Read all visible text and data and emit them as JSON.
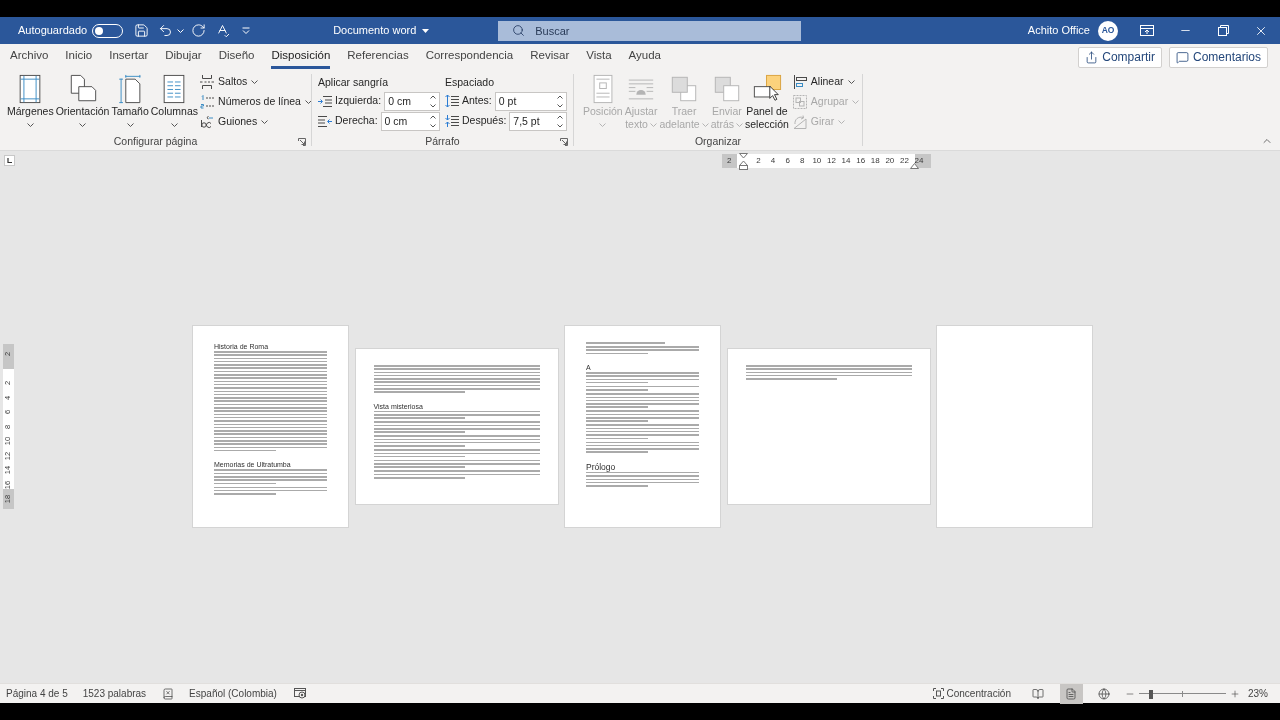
{
  "title_bar": {
    "autosave": {
      "label": "Autoguardado",
      "on": false
    },
    "document_title": "Documento word",
    "search": {
      "placeholder": "Buscar"
    },
    "user": {
      "name": "Achito Office",
      "initials": "AO"
    }
  },
  "tabs": [
    {
      "label": "Archivo",
      "selected": false
    },
    {
      "label": "Inicio",
      "selected": false
    },
    {
      "label": "Insertar",
      "selected": false
    },
    {
      "label": "Dibujar",
      "selected": false
    },
    {
      "label": "Diseño",
      "selected": false
    },
    {
      "label": "Disposición",
      "selected": true
    },
    {
      "label": "Referencias",
      "selected": false
    },
    {
      "label": "Correspondencia",
      "selected": false
    },
    {
      "label": "Revisar",
      "selected": false
    },
    {
      "label": "Vista",
      "selected": false
    },
    {
      "label": "Ayuda",
      "selected": false
    }
  ],
  "header_buttons": [
    {
      "kind": "share",
      "label": "Compartir"
    },
    {
      "kind": "comments",
      "label": "Comentarios"
    }
  ],
  "ribbon": {
    "page_setup": {
      "label": "Configurar página",
      "large_buttons": [
        {
          "kind": "margins",
          "lines": [
            "Márgenes"
          ],
          "menu": true
        },
        {
          "kind": "orientation",
          "lines": [
            "Orientación"
          ],
          "menu": true
        },
        {
          "kind": "size",
          "lines": [
            "Tamaño"
          ],
          "menu": true
        },
        {
          "kind": "columns",
          "lines": [
            "Columnas"
          ],
          "menu": true
        }
      ],
      "small_buttons": [
        {
          "kind": "breaks",
          "label": "Saltos",
          "menu": true
        },
        {
          "kind": "line_numbers",
          "label": "Números de línea",
          "menu": true
        },
        {
          "kind": "hyphenation",
          "label": "Guiones",
          "menu": true
        }
      ]
    },
    "paragraph": {
      "label": "Párrafo",
      "sections": [
        {
          "label": "Aplicar sangría",
          "fields": [
            {
              "kind": "indent_left",
              "label": "Izquierda:",
              "value": "0 cm"
            },
            {
              "kind": "indent_right",
              "label": "Derecha:",
              "value": "0 cm"
            }
          ]
        },
        {
          "label": "Espaciado",
          "fields": [
            {
              "kind": "spacing_before",
              "label": "Antes:",
              "value": "0 pt"
            },
            {
              "kind": "spacing_after",
              "label": "Después:",
              "value": "7,5 pt"
            }
          ]
        }
      ]
    },
    "arrange": {
      "label": "Organizar",
      "large_buttons": [
        {
          "kind": "position",
          "lines": [
            "Posición"
          ],
          "menu": true,
          "disabled": true
        },
        {
          "kind": "wrap_text",
          "lines": [
            "Ajustar",
            "texto"
          ],
          "menu": true,
          "disabled": true
        },
        {
          "kind": "bring_forward",
          "lines": [
            "Traer",
            "adelante"
          ],
          "menu": true,
          "disabled": true
        },
        {
          "kind": "send_backward",
          "lines": [
            "Enviar",
            "atrás"
          ],
          "menu": true,
          "disabled": true
        },
        {
          "kind": "selection_pane",
          "lines": [
            "Panel de",
            "selección"
          ],
          "menu": false,
          "disabled": false
        }
      ],
      "small_buttons": [
        {
          "kind": "align",
          "label": "Alinear",
          "menu": true,
          "disabled": false
        },
        {
          "kind": "group",
          "label": "Agrupar",
          "menu": true,
          "disabled": true
        },
        {
          "kind": "rotate",
          "label": "Girar",
          "menu": true,
          "disabled": true
        }
      ]
    }
  },
  "horizontal_ruler": {
    "ticks": [
      "2",
      "2",
      "4",
      "6",
      "8",
      "10",
      "12",
      "14",
      "16",
      "18",
      "20",
      "22",
      "24"
    ]
  },
  "vertical_ruler": {
    "ticks": [
      "2",
      "2",
      "4",
      "6",
      "8",
      "10",
      "12",
      "14",
      "16",
      "18"
    ]
  },
  "pages": [
    {
      "kind": "portrait",
      "blocks": [
        {
          "kind": "heading",
          "text": "Historia de Roma"
        },
        {
          "kind": "text_block"
        },
        {
          "kind": "heading",
          "text": "Memorias de Ultratumba"
        },
        {
          "kind": "five_lines"
        },
        {
          "kind": "three_lines"
        }
      ]
    },
    {
      "kind": "landscape",
      "blocks": [
        {
          "kind": "nine_lines"
        },
        {
          "kind": "heading",
          "text": "Vista misteriosa"
        },
        {
          "kind": "three_lines"
        },
        {
          "kind": "four_lines"
        },
        {
          "kind": "four_lines"
        },
        {
          "kind": "three_lines"
        },
        {
          "kind": "three_lines"
        },
        {
          "kind": "three_lines"
        }
      ]
    },
    {
      "kind": "portrait",
      "blocks": [
        {
          "kind": "one_line"
        },
        {
          "kind": "three_lines"
        },
        {
          "kind": "heading",
          "text": "A"
        },
        {
          "kind": "four_lines"
        },
        {
          "kind": "two_lines"
        },
        {
          "kind": "five_lines"
        },
        {
          "kind": "four_lines"
        },
        {
          "kind": "five_lines"
        },
        {
          "kind": "four_lines"
        },
        {
          "kind": "heading_large",
          "text": "Prólogo"
        },
        {
          "kind": "five_lines"
        }
      ]
    },
    {
      "kind": "landscape",
      "blocks": [
        {
          "kind": "five_lines"
        }
      ]
    },
    {
      "kind": "portrait"
    }
  ],
  "status_bar": {
    "page": "Página 4 de 5",
    "words": "1523 palabras",
    "language": "Español (Colombia)",
    "focus": "Concentración",
    "views": [
      {
        "kind": "read_mode",
        "selected": false
      },
      {
        "kind": "print_layout",
        "selected": true
      },
      {
        "kind": "web_layout",
        "selected": false
      }
    ],
    "zoom": {
      "level": 0.12,
      "reading": "23%"
    }
  }
}
